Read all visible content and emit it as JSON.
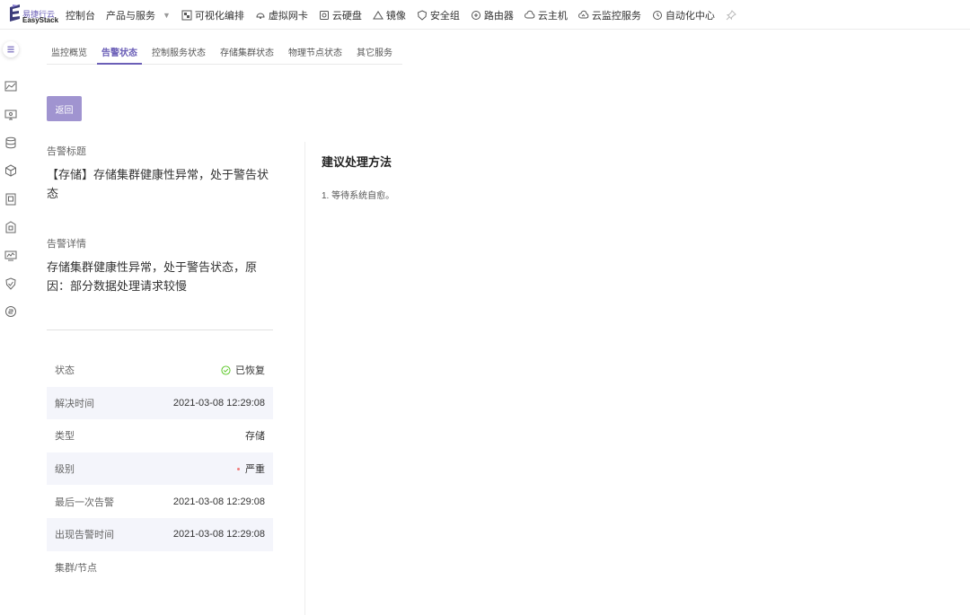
{
  "brand": {
    "name_cn": "易捷行云",
    "name_en": "EasyStack"
  },
  "nav": {
    "items": [
      {
        "label": "控制台",
        "icon": ""
      },
      {
        "label": "产品与服务",
        "icon": "chevron-down"
      },
      {
        "label": "可视化编排",
        "icon": "orchestration-icon"
      },
      {
        "label": "虚拟网卡",
        "icon": "nic-icon"
      },
      {
        "label": "云硬盘",
        "icon": "disk-icon"
      },
      {
        "label": "镜像",
        "icon": "image-icon"
      },
      {
        "label": "安全组",
        "icon": "shield-icon"
      },
      {
        "label": "路由器",
        "icon": "router-icon"
      },
      {
        "label": "云主机",
        "icon": "cloud-host-icon"
      },
      {
        "label": "云监控服务",
        "icon": "cloud-monitor-icon"
      },
      {
        "label": "自动化中心",
        "icon": "automation-icon"
      }
    ],
    "pin_icon": "pin-icon"
  },
  "tabs": [
    {
      "label": "监控概览",
      "active": false
    },
    {
      "label": "告警状态",
      "active": true
    },
    {
      "label": "控制服务状态",
      "active": false
    },
    {
      "label": "存储集群状态",
      "active": false
    },
    {
      "label": "物理节点状态",
      "active": false
    },
    {
      "label": "其它服务",
      "active": false
    }
  ],
  "back_button": "返回",
  "alert": {
    "title_label": "告警标题",
    "title": "【存储】存储集群健康性异常，处于警告状态",
    "detail_label": "告警详情",
    "detail": "存储集群健康性异常，处于警告状态，原因：部分数据处理请求较慢"
  },
  "details": [
    {
      "key": "状态",
      "value": "已恢复",
      "icon": "check-circle-icon"
    },
    {
      "key": "解决时间",
      "value": "2021-03-08 12:29:08"
    },
    {
      "key": "类型",
      "value": "存储"
    },
    {
      "key": "级别",
      "value": "严重",
      "dot": true
    },
    {
      "key": "最后一次告警",
      "value": "2021-03-08 12:29:08"
    },
    {
      "key": "出现告警时间",
      "value": "2021-03-08 12:29:08"
    },
    {
      "key": "集群/节点",
      "value": ""
    }
  ],
  "suggestion": {
    "title": "建议处理方法",
    "text": "1. 等待系统自愈。"
  },
  "colors": {
    "accent": "#6b5fb7",
    "button": "#a094d0",
    "success": "#52c41a",
    "danger": "#f07b7b"
  }
}
